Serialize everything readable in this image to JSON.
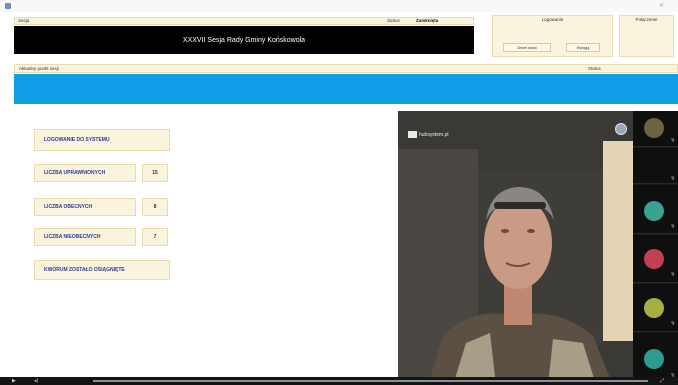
{
  "header": {
    "session_label": "Sesja",
    "session_name": "XXXVII Sesja Rady Gminy Końskowola",
    "status_label": "Status",
    "status_value": "Zamknięta",
    "login_label": "Logowanie",
    "login_user": "",
    "change_password_label": "Zmień hasło",
    "logout_label": "Wyloguj",
    "connection_label": "Połączenie",
    "connection_value": "",
    "connection_time": ""
  },
  "current_point": {
    "label": "Aktualny punkt sesji",
    "status_label": "Status"
  },
  "stats": {
    "login_title": "LOGOWANIE DO SYSTEMU",
    "entitled_label": "LICZBA UPRAWNIONYCH",
    "entitled_value": "15",
    "present_label": "LICZBA OBECNYCH",
    "present_value": "8",
    "absent_label": "LICZBA NIEOBECNYCH",
    "absent_value": "7",
    "quorum_label": "KWORUM ZOSTAŁO OSIĄGNIĘTE"
  },
  "video": {
    "logo_text": "hubsystem.pl"
  },
  "participants": [
    {
      "name": "",
      "color": "#6a6440"
    },
    {
      "name": "",
      "color": "#3a3a3a"
    },
    {
      "name": "",
      "color": "#3aa090"
    },
    {
      "name": "",
      "color": "#c04055"
    },
    {
      "name": "",
      "color": "#a6b040"
    },
    {
      "name": "",
      "color": "#2a9c92"
    }
  ],
  "colors": {
    "accent_blue": "#109ee6",
    "tile_bg": "#fbf4dc",
    "tile_text": "#2d3a9a",
    "online_green": "#2e8f2e"
  }
}
